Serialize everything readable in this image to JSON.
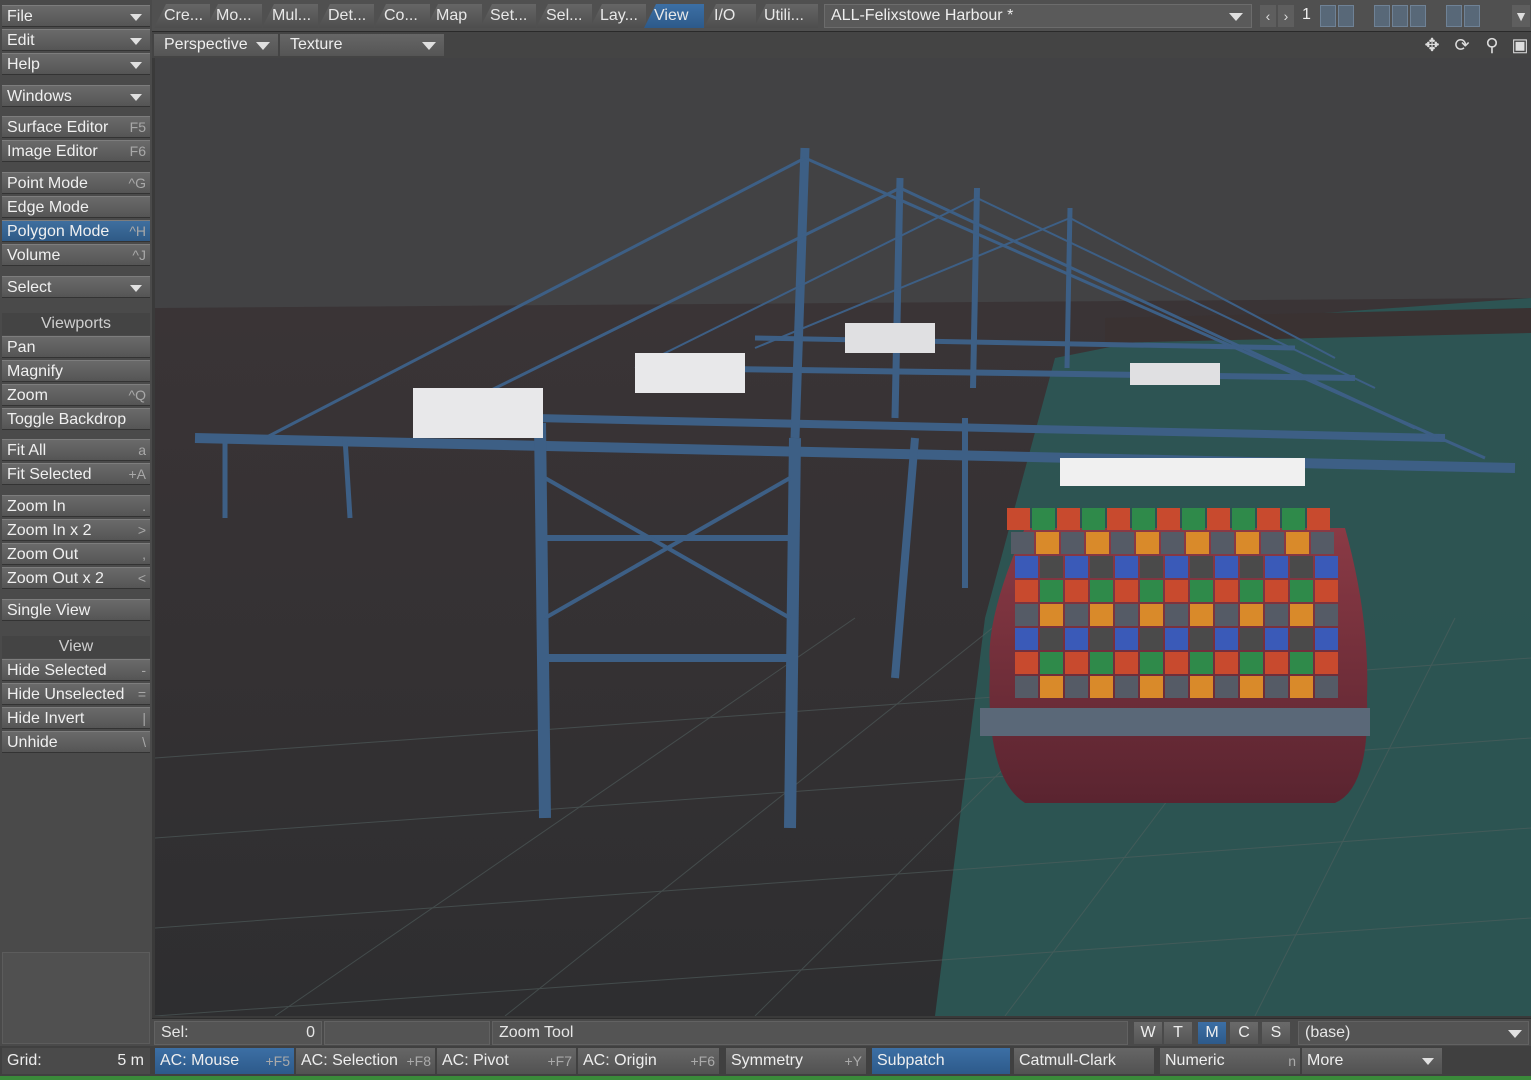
{
  "sidebar": {
    "menus": [
      {
        "label": "File"
      },
      {
        "label": "Edit"
      },
      {
        "label": "Help"
      },
      {
        "label": "Windows"
      }
    ],
    "editors": [
      {
        "label": "Surface Editor",
        "shortcut": "F5"
      },
      {
        "label": "Image Editor",
        "shortcut": "F6"
      }
    ],
    "modes": [
      {
        "label": "Point Mode",
        "shortcut": "^G"
      },
      {
        "label": "Edge Mode",
        "shortcut": ""
      },
      {
        "label": "Polygon Mode",
        "shortcut": "^H"
      },
      {
        "label": "Volume",
        "shortcut": "^J"
      }
    ],
    "select_label": "Select",
    "viewports_header": "Viewports",
    "viewports": [
      {
        "label": "Pan",
        "shortcut": ""
      },
      {
        "label": "Magnify",
        "shortcut": ""
      },
      {
        "label": "Zoom",
        "shortcut": "^Q"
      },
      {
        "label": "Toggle Backdrop",
        "shortcut": ""
      }
    ],
    "fit": [
      {
        "label": "Fit All",
        "shortcut": "a"
      },
      {
        "label": "Fit Selected",
        "shortcut": "+A"
      }
    ],
    "zooms": [
      {
        "label": "Zoom In",
        "shortcut": "."
      },
      {
        "label": "Zoom In x 2",
        "shortcut": ">"
      },
      {
        "label": "Zoom Out",
        "shortcut": ","
      },
      {
        "label": "Zoom Out x 2",
        "shortcut": "<"
      }
    ],
    "single_view": "Single View",
    "view_header": "View",
    "view": [
      {
        "label": "Hide Selected",
        "shortcut": "-"
      },
      {
        "label": "Hide Unselected",
        "shortcut": "="
      },
      {
        "label": "Hide Invert",
        "shortcut": "|"
      },
      {
        "label": "Unhide",
        "shortcut": "\\"
      }
    ]
  },
  "tabs": [
    "Cre...",
    "Mo...",
    "Mul...",
    "Det...",
    "Co...",
    "Map",
    "Set...",
    "Sel...",
    "Lay...",
    "View",
    "I/O",
    "Utili..."
  ],
  "active_tab": "View",
  "scene": "ALL-Felixstowe Harbour *",
  "layer_number": "1",
  "viewport": {
    "projection": "Perspective",
    "render_mode": "Texture",
    "icons": [
      "move-icon",
      "rotate-icon",
      "zoom-icon",
      "maximize-icon"
    ]
  },
  "status": {
    "sel_label": "Sel:",
    "sel_value": "0",
    "tool_label": "Zoom Tool",
    "wtmcs": [
      "W",
      "T",
      "M",
      "C",
      "S"
    ],
    "active_wtmcs": "M",
    "layer": "(base)"
  },
  "bottom": {
    "grid_label": "Grid:",
    "grid_value": "5 m",
    "buttons": [
      {
        "label": "AC: Mouse",
        "shortcut": "+F5",
        "active": true
      },
      {
        "label": "AC: Selection",
        "shortcut": "+F8",
        "active": false
      },
      {
        "label": "AC: Pivot",
        "shortcut": "+F7",
        "active": false
      },
      {
        "label": "AC: Origin",
        "shortcut": "+F6",
        "active": false
      },
      {
        "label": "Symmetry",
        "shortcut": "+Y",
        "active": false
      },
      {
        "label": "Subpatch",
        "shortcut": "",
        "active": true
      },
      {
        "label": "Catmull-Clark",
        "shortcut": "",
        "active": false
      },
      {
        "label": "Numeric",
        "shortcut": "n",
        "active": false
      }
    ],
    "more_label": "More"
  },
  "colors": {
    "accent": "#2f5a86",
    "crane": "#3d5f85",
    "sea": "#2c5a58",
    "hull": "#7a2f3a"
  }
}
